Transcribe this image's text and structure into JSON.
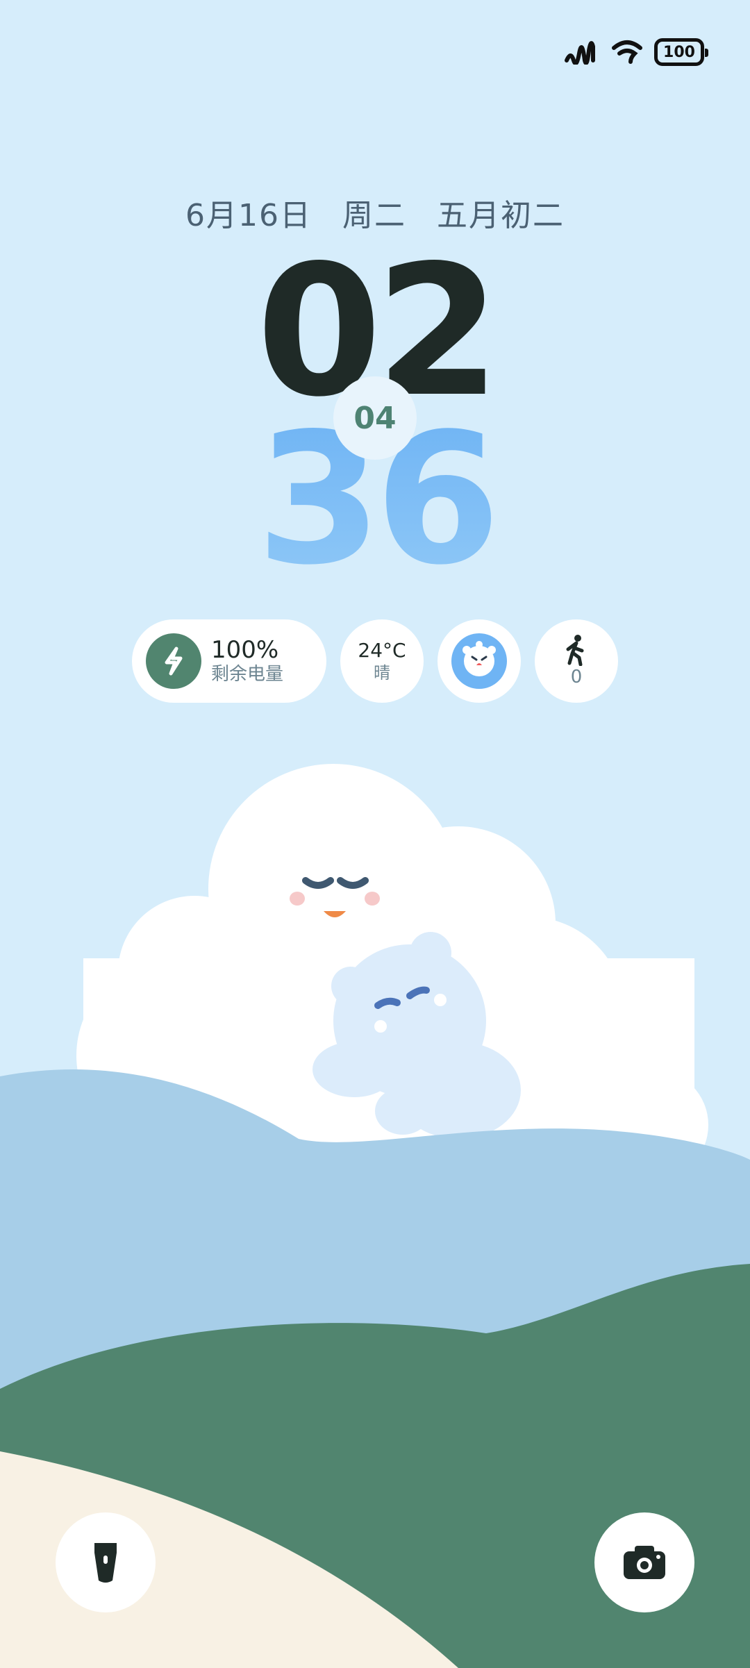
{
  "status_bar": {
    "signal_icon": "signal-icon",
    "wifi_icon": "wifi-icon",
    "battery_level": "100"
  },
  "lockscreen": {
    "date": "6月16日",
    "weekday": "周二",
    "lunar_date": "五月初二",
    "hour": "02",
    "minute": "36",
    "second": "04"
  },
  "widgets": {
    "battery": {
      "percent": "100%",
      "label": "剩余电量"
    },
    "weather": {
      "temp": "24°C",
      "condition": "晴"
    },
    "steps": {
      "count": "0"
    }
  },
  "shortcuts": {
    "flashlight_icon": "flashlight-icon",
    "camera_icon": "camera-icon"
  },
  "colors": {
    "sky": "#d6edfb",
    "hill_blue": "#a7cee8",
    "hill_green": "#51856f",
    "sand": "#f8f1e4",
    "accent_blue": "#6fb4f4",
    "clock_dark": "#1f2a27"
  }
}
